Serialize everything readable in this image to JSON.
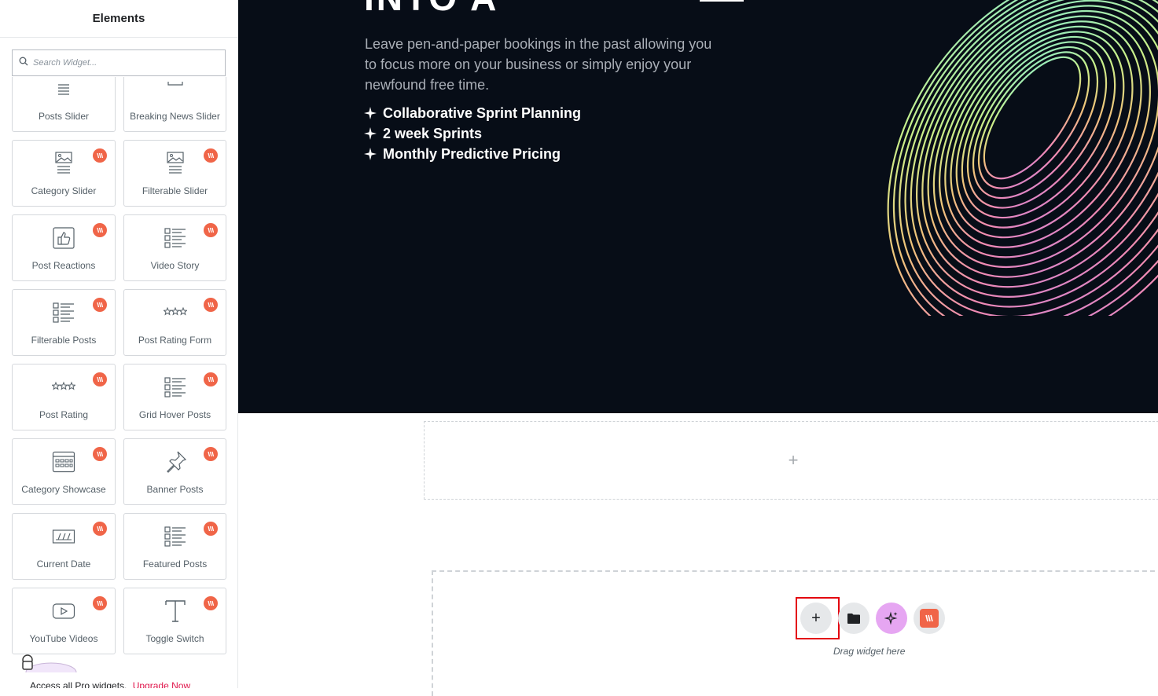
{
  "sidebar": {
    "title": "Elements",
    "search_placeholder": "Search Widget...",
    "widgets": [
      {
        "label": "Posts Slider",
        "icon": "lines-icon",
        "pro": false
      },
      {
        "label": "Breaking News Slider",
        "icon": "slider-icon",
        "pro": false
      },
      {
        "label": "Category Slider",
        "icon": "image-lines-icon",
        "pro": true
      },
      {
        "label": "Filterable Slider",
        "icon": "image-lines-icon",
        "pro": true
      },
      {
        "label": "Post Reactions",
        "icon": "thumbs-up-icon",
        "pro": true
      },
      {
        "label": "Video Story",
        "icon": "list-icon",
        "pro": true
      },
      {
        "label": "Filterable Posts",
        "icon": "list-icon",
        "pro": true
      },
      {
        "label": "Post Rating Form",
        "icon": "stars-icon",
        "pro": true
      },
      {
        "label": "Post Rating",
        "icon": "stars-icon",
        "pro": true
      },
      {
        "label": "Grid Hover Posts",
        "icon": "list-icon",
        "pro": true
      },
      {
        "label": "Category Showcase",
        "icon": "calendar-grid-icon",
        "pro": true
      },
      {
        "label": "Banner Posts",
        "icon": "pin-icon",
        "pro": true
      },
      {
        "label": "Current Date",
        "icon": "date-icon",
        "pro": true
      },
      {
        "label": "Featured Posts",
        "icon": "list-icon",
        "pro": true
      },
      {
        "label": "YouTube Videos",
        "icon": "play-icon",
        "pro": true
      },
      {
        "label": "Toggle Switch",
        "icon": "text-icon",
        "pro": true
      }
    ],
    "footer_text": "Access all Pro widgets.",
    "footer_link": "Upgrade Now"
  },
  "hero": {
    "title_fragment": "INTO A",
    "description": "Leave pen-and-paper bookings in the past allowing you to focus more on your business or simply enjoy your newfound free time.",
    "features": [
      "Collaborative Sprint Planning",
      "2 week Sprints",
      "Monthly Predictive Pricing"
    ]
  },
  "canvas": {
    "add_section_symbol": "+",
    "add_button_symbol": "+",
    "drag_label": "Drag widget here"
  },
  "colors": {
    "hero_bg": "#070d17",
    "pro_badge": "#f06548",
    "ai_button": "#e6a6f2",
    "highlight": "#e3000f"
  }
}
